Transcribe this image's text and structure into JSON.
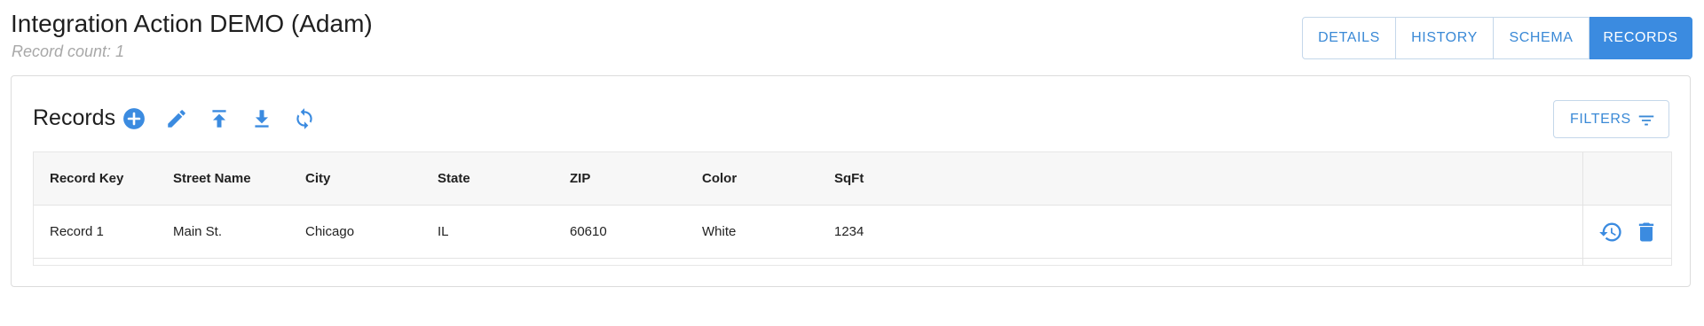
{
  "header": {
    "title": "Integration Action DEMO (Adam)",
    "record_count": "Record count: 1"
  },
  "tabs": [
    {
      "label": "DETAILS",
      "active": false
    },
    {
      "label": "HISTORY",
      "active": false
    },
    {
      "label": "SCHEMA",
      "active": false
    },
    {
      "label": "RECORDS",
      "active": true
    }
  ],
  "records": {
    "title": "Records",
    "toolbar": {
      "add": "add-circle-icon",
      "edit": "pencil-icon",
      "upload": "upload-icon",
      "download": "download-icon",
      "refresh": "sync-icon"
    },
    "filters_label": "FILTERS",
    "columns": [
      "Record Key",
      "Street Name",
      "City",
      "State",
      "ZIP",
      "Color",
      "SqFt"
    ],
    "rows": [
      {
        "cells": [
          "Record 1",
          "Main St.",
          "Chicago",
          "IL",
          "60610",
          "White",
          "1234"
        ]
      }
    ],
    "row_actions": [
      "history-icon",
      "trash-icon"
    ]
  },
  "colors": {
    "accent": "#3b8be0",
    "tab_text": "#3a89d6",
    "muted": "#a8a8a8"
  }
}
